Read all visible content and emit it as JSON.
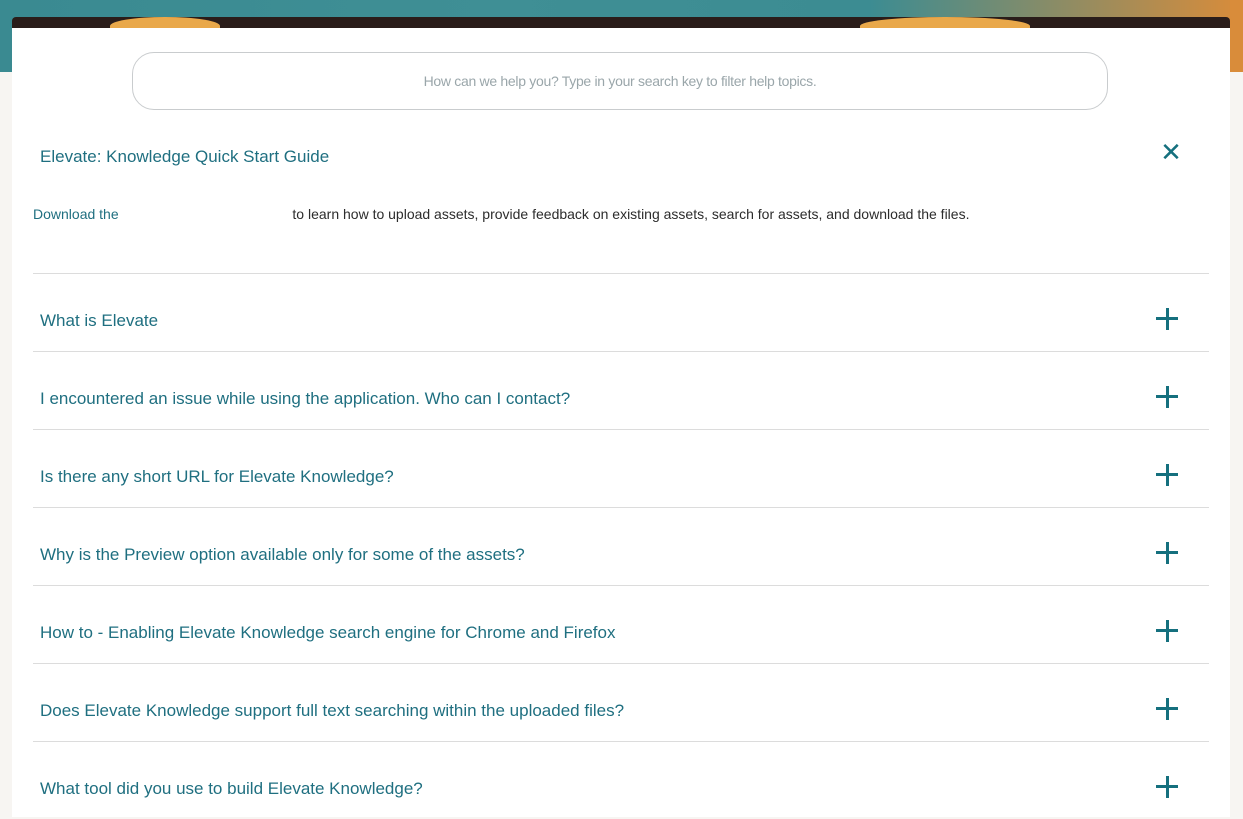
{
  "search": {
    "placeholder": "How can we help you? Type in your search key to filter help topics."
  },
  "open_item": {
    "title": "Elevate: Knowledge Quick Start Guide",
    "body_prefix": "Download the",
    "body_suffix": "to learn how to upload assets, provide feedback on existing assets, search for assets, and download the files."
  },
  "faq": [
    {
      "question": "What is Elevate"
    },
    {
      "question": "I encountered an issue while using the application. Who can I contact?"
    },
    {
      "question": "Is there any short URL for Elevate Knowledge?"
    },
    {
      "question": "Why is the Preview option available only for some of the assets?"
    },
    {
      "question": "How to - Enabling Elevate Knowledge search engine for Chrome and Firefox"
    },
    {
      "question": "Does Elevate Knowledge support full text searching within the uploaded files?"
    },
    {
      "question": "What tool did you use to build Elevate Knowledge?"
    }
  ],
  "icons": {
    "close": "close-icon",
    "expand": "plus-icon"
  },
  "colors": {
    "accent": "#15707e",
    "question_text": "#1f6f80"
  }
}
